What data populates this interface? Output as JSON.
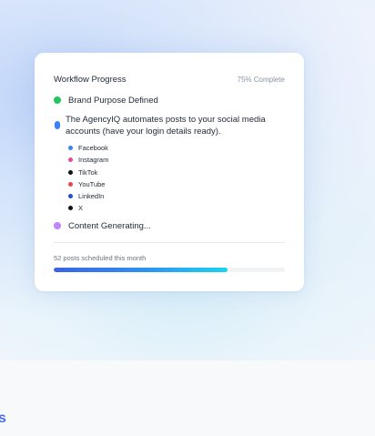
{
  "workflow": {
    "title": "Workflow Progress",
    "status": "75% Complete",
    "progress_fraction": 0.75,
    "steps": [
      {
        "label": "Brand Purpose Defined",
        "color": "#22c55e",
        "state": "done"
      },
      {
        "label": "The AgencyIQ automates posts to your social media accounts (have your login details ready).",
        "color": "#3b82f6",
        "state": "active"
      },
      {
        "label": "Content Generating...",
        "color": "#c084fc",
        "state": "pending"
      }
    ],
    "platforms": [
      {
        "label": "Facebook",
        "color": "#3b82f6"
      },
      {
        "label": "Instagram",
        "color": "#ec4899"
      },
      {
        "label": "TikTok",
        "color": "#111111"
      },
      {
        "label": "YouTube",
        "color": "#ef4444"
      },
      {
        "label": "LinkedIn",
        "color": "#1d4ed8"
      },
      {
        "label": "X",
        "color": "#111111"
      }
    ],
    "scheduled_text": "52 posts scheduled this month"
  },
  "page": {
    "corner_text": "s",
    "accent": "#4f6ff0"
  }
}
